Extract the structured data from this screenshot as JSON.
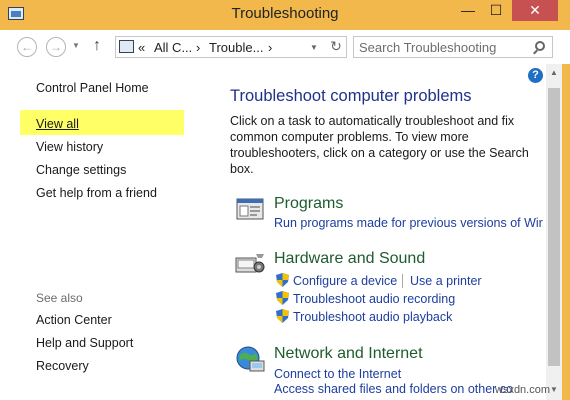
{
  "window": {
    "title": "Troubleshooting",
    "minimize": "—",
    "maximize": "☐",
    "close": "✕",
    "accent_color": "#f2b84b",
    "close_color": "#c75050"
  },
  "nav": {
    "back": "←",
    "forward": "→",
    "up": "↑",
    "address_segments": [
      "«",
      "All C...",
      "›",
      "Trouble...",
      "›"
    ],
    "search_placeholder": "Search Troubleshooting"
  },
  "left_pane": {
    "items": [
      "Control Panel Home",
      "View all",
      "View history",
      "Change settings",
      "Get help from a friend"
    ],
    "see_also_label": "See also",
    "see_also_items": [
      "Action Center",
      "Help and Support",
      "Recovery"
    ]
  },
  "main": {
    "heading": "Troubleshoot computer problems",
    "intro": "Click on a task to automatically troubleshoot and fix common computer problems. To view more troubleshooters, click on a category or use the Search box.",
    "categories": [
      {
        "title": "Programs",
        "links": [
          "Run programs made for previous versions of Wir"
        ]
      },
      {
        "title": "Hardware and Sound",
        "links": [
          "Configure a device",
          "Use a printer",
          "Troubleshoot audio recording",
          "Troubleshoot audio playback"
        ]
      },
      {
        "title": "Network and Internet",
        "links": [
          "Connect to the Internet",
          "Access shared files and folders on other co"
        ]
      }
    ]
  },
  "help": "?",
  "watermark": "wsxdn.com"
}
